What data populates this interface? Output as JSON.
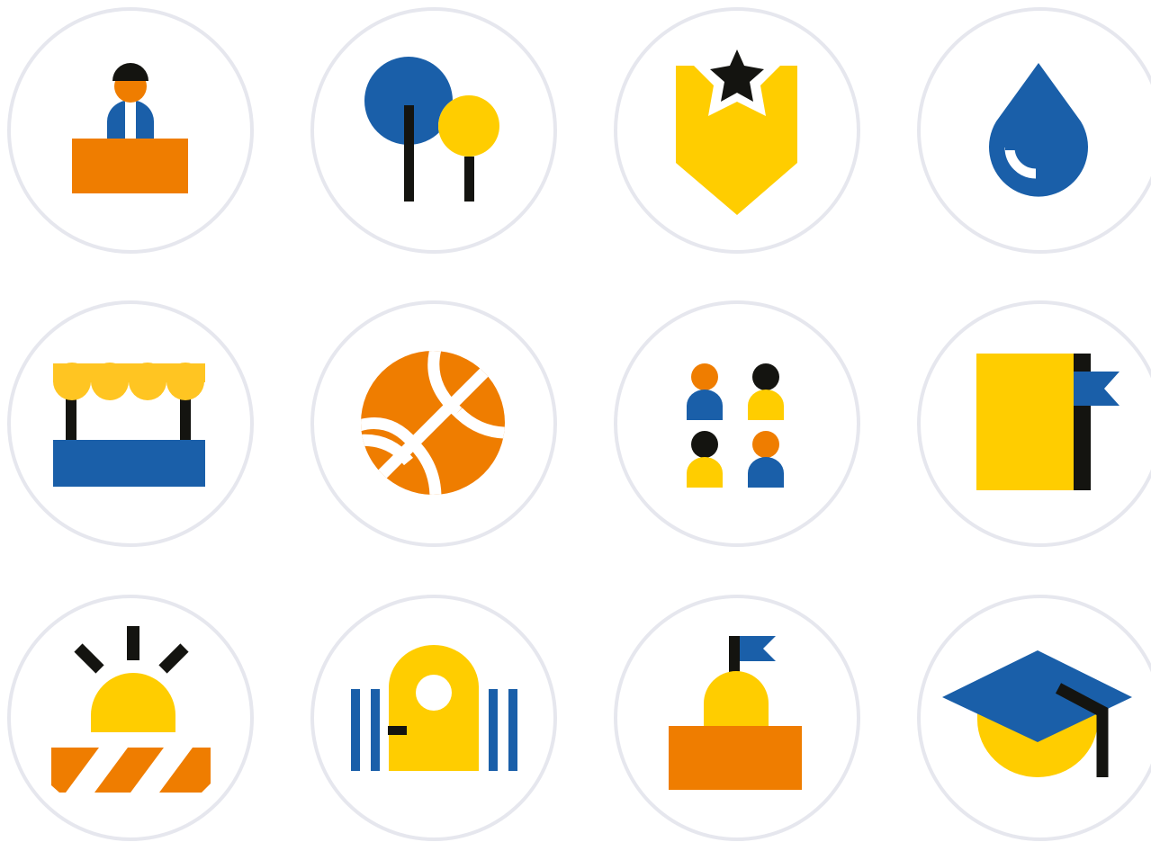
{
  "colors": {
    "blue": "#1a5fa9",
    "orange": "#ef7d00",
    "yellow": "#ffcd00",
    "black": "#141410",
    "ring": "#e6e7ee",
    "background": "#ffffff"
  },
  "icons": [
    "reception-desk-icon",
    "trees-icon",
    "star-badge-icon",
    "water-drop-icon",
    "market-stall-icon",
    "basketball-icon",
    "people-group-icon",
    "flag-board-icon",
    "alarm-barrier-icon",
    "gate-door-icon",
    "monument-flag-icon",
    "graduation-cap-icon"
  ]
}
